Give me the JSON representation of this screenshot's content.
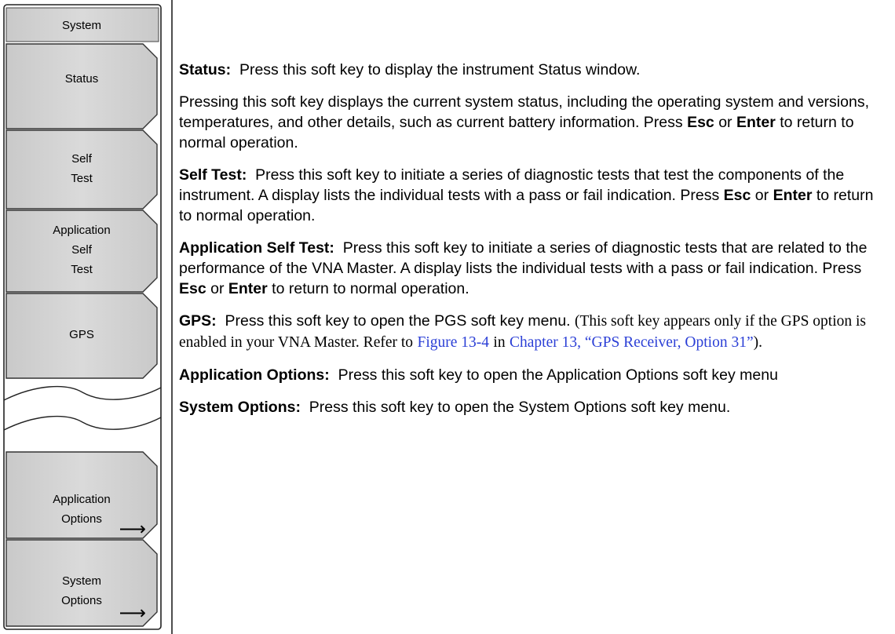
{
  "menu": {
    "title": "System",
    "keys": [
      {
        "lines": [
          "Status"
        ]
      },
      {
        "lines": [
          "Self",
          "Test"
        ]
      },
      {
        "lines": [
          "Application",
          "Self",
          "Test"
        ]
      },
      {
        "lines": [
          "GPS"
        ]
      },
      {
        "lines": [
          "Application",
          "Options"
        ],
        "submenu": true
      },
      {
        "lines": [
          "System",
          "Options"
        ],
        "submenu": true
      }
    ],
    "arrow_glyph": "⟶"
  },
  "descriptions": {
    "status": {
      "term": "Status:",
      "text": "Press this soft key to display the instrument Status window."
    },
    "status_detail": {
      "a": "Pressing this soft key displays the current system status, including the operating system and  versions, temperatures, and other details, such as current battery information. Press",
      "esc": "Esc",
      "or": "or",
      "enter": "Enter",
      "b": "to return to normal operation."
    },
    "self_test": {
      "term": "Self Test:",
      "a": "Press this soft key to initiate a series of diagnostic tests that test the components of the instrument. A display lists the individual tests with a pass or fail indication. Press",
      "esc": "Esc",
      "or": "or",
      "enter": "Enter",
      "b": "to return to normal operation."
    },
    "app_self_test": {
      "term": "Application Self Test:",
      "a": "Press this soft key to initiate a series of diagnostic tests that are related to the performance of the VNA Master. A display lists the individual tests with a pass or fail indication. Press",
      "esc": "Esc",
      "or": "or",
      "enter": "Enter",
      "b": "to return to normal operation."
    },
    "gps": {
      "term": "GPS:",
      "a": "Press this soft key to open the PGS soft key menu.",
      "serif_a": "(This soft key appears only if the GPS option is enabled in your VNA Master. Refer to",
      "link_figure": "Figure 13-4",
      "in": "in",
      "link_chapter": "Chapter 13, “GPS Receiver, Option 31”",
      "close": ")."
    },
    "app_options": {
      "term": "Application Options:",
      "text": "Press this soft key to open the Application Options soft key menu"
    },
    "sys_options": {
      "term": "System Options:",
      "text": "Press this soft key to open the System Options soft key menu."
    }
  }
}
